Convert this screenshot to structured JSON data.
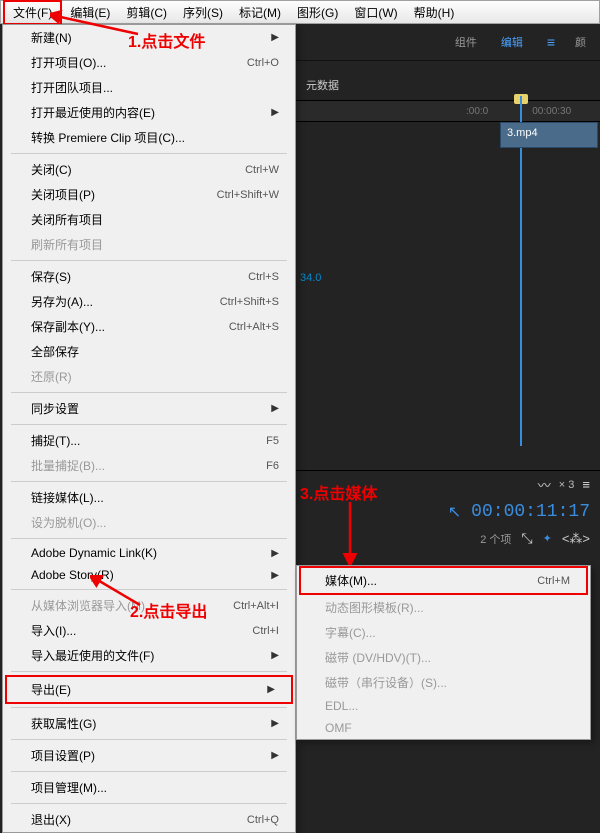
{
  "menubar": [
    "文件(F)",
    "编辑(E)",
    "剪辑(C)",
    "序列(S)",
    "标记(M)",
    "图形(G)",
    "窗口(W)",
    "帮助(H)"
  ],
  "dropdown": [
    {
      "label": "新建(N)",
      "arrow": true
    },
    {
      "label": "打开项目(O)...",
      "shortcut": "Ctrl+O"
    },
    {
      "label": "打开团队项目..."
    },
    {
      "label": "打开最近使用的内容(E)",
      "arrow": true
    },
    {
      "label": "转换 Premiere Clip 项目(C)..."
    },
    {
      "sep": true
    },
    {
      "label": "关闭(C)",
      "shortcut": "Ctrl+W"
    },
    {
      "label": "关闭项目(P)",
      "shortcut": "Ctrl+Shift+W"
    },
    {
      "label": "关闭所有项目"
    },
    {
      "label": "刷新所有项目",
      "disabled": true
    },
    {
      "sep": true
    },
    {
      "label": "保存(S)",
      "shortcut": "Ctrl+S"
    },
    {
      "label": "另存为(A)...",
      "shortcut": "Ctrl+Shift+S"
    },
    {
      "label": "保存副本(Y)...",
      "shortcut": "Ctrl+Alt+S"
    },
    {
      "label": "全部保存"
    },
    {
      "label": "还原(R)",
      "disabled": true
    },
    {
      "sep": true
    },
    {
      "label": "同步设置",
      "arrow": true
    },
    {
      "sep": true
    },
    {
      "label": "捕捉(T)...",
      "shortcut": "F5"
    },
    {
      "label": "批量捕捉(B)...",
      "shortcut": "F6",
      "disabled": true
    },
    {
      "sep": true
    },
    {
      "label": "链接媒体(L)..."
    },
    {
      "label": "设为脱机(O)...",
      "disabled": true
    },
    {
      "sep": true
    },
    {
      "label": "Adobe Dynamic Link(K)",
      "arrow": true
    },
    {
      "label": "Adobe Story(R)",
      "arrow": true
    },
    {
      "sep": true
    },
    {
      "label": "从媒体浏览器导入(M)",
      "shortcut": "Ctrl+Alt+I",
      "disabled": true
    },
    {
      "label": "导入(I)...",
      "shortcut": "Ctrl+I"
    },
    {
      "label": "导入最近使用的文件(F)",
      "arrow": true
    },
    {
      "sep": true
    },
    {
      "label": "导出(E)",
      "arrow": true,
      "boxed": true
    },
    {
      "sep": true
    },
    {
      "label": "获取属性(G)",
      "arrow": true
    },
    {
      "sep": true
    },
    {
      "label": "项目设置(P)",
      "arrow": true
    },
    {
      "sep": true
    },
    {
      "label": "项目管理(M)..."
    },
    {
      "sep": true
    },
    {
      "label": "退出(X)",
      "shortcut": "Ctrl+Q"
    }
  ],
  "submenu": [
    {
      "label": "媒体(M)...",
      "shortcut": "Ctrl+M",
      "boxed": true
    },
    {
      "label": "动态图形模板(R)...",
      "disabled": true
    },
    {
      "label": "字幕(C)...",
      "disabled": true
    },
    {
      "label": "磁带 (DV/HDV)(T)...",
      "disabled": true
    },
    {
      "label": "磁带（串行设备）(S)...",
      "disabled": true
    },
    {
      "label": "EDL...",
      "disabled": true
    },
    {
      "label": "OMF",
      "disabled": true
    }
  ],
  "tabs": {
    "components": "组件",
    "edit": "编辑",
    "color": "颜"
  },
  "meta_label": "元数据",
  "ruler": {
    "tc1": ":00:0",
    "tc2": "00:00:30"
  },
  "clip_name": "3.mp4",
  "seq_tab": "× 3",
  "timecode": "00:00:11:17",
  "items_text": "2 个项",
  "num_text": "34.0",
  "annotations": {
    "a1": "1.点击文件",
    "a2": "2.点击导出",
    "a3": "3.点击媒体"
  }
}
